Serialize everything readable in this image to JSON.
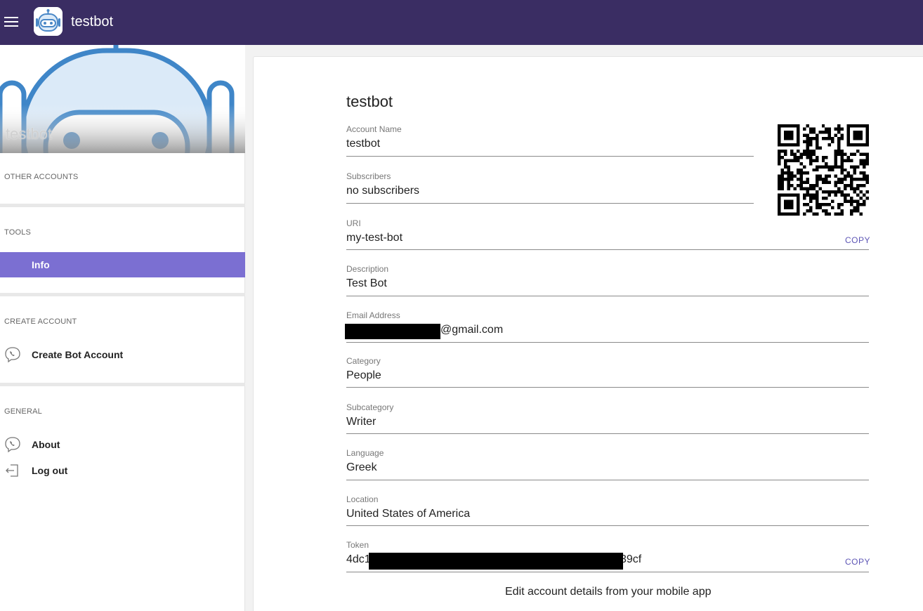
{
  "header": {
    "title": "testbot",
    "menu_icon": "hamburger-menu-icon",
    "logo_icon": "robot-logo-icon",
    "background_color": "#3a2d63"
  },
  "sidebar": {
    "hero_name": "testbot",
    "sections": {
      "other_accounts": "OTHER ACCOUNTS",
      "tools": "TOOLS",
      "create_account": "CREATE ACCOUNT",
      "general": "GENERAL"
    },
    "items": {
      "info": {
        "label": "Info",
        "active": true
      },
      "create_bot": {
        "label": "Create Bot Account",
        "icon": "viber-phone-icon"
      },
      "about": {
        "label": "About",
        "icon": "viber-phone-icon"
      },
      "logout": {
        "label": "Log out",
        "icon": "logout-icon"
      }
    },
    "accent_color": "#7b6fd2"
  },
  "main": {
    "title": "testbot",
    "fields": {
      "account_name": {
        "label": "Account Name",
        "value": "testbot"
      },
      "subscribers": {
        "label": "Subscribers",
        "value": "no subscribers"
      },
      "uri": {
        "label": "URI",
        "value": "my-test-bot",
        "copy": "COPY"
      },
      "description": {
        "label": "Description",
        "value": "Test Bot"
      },
      "email": {
        "label": "Email Address",
        "value_visible": "@gmail.com"
      },
      "category": {
        "label": "Category",
        "value": "People"
      },
      "subcategory": {
        "label": "Subcategory",
        "value": "Writer"
      },
      "language": {
        "label": "Language",
        "value": "Greek"
      },
      "location": {
        "label": "Location",
        "value": "United States of America"
      },
      "token": {
        "label": "Token",
        "value_prefix": "4dc1",
        "value_suffix": "39cf",
        "copy": "COPY"
      }
    },
    "qr_icon": "qr-code-icon",
    "footer_note": "Edit account details from your mobile app",
    "copy_color": "#5d55b5"
  }
}
